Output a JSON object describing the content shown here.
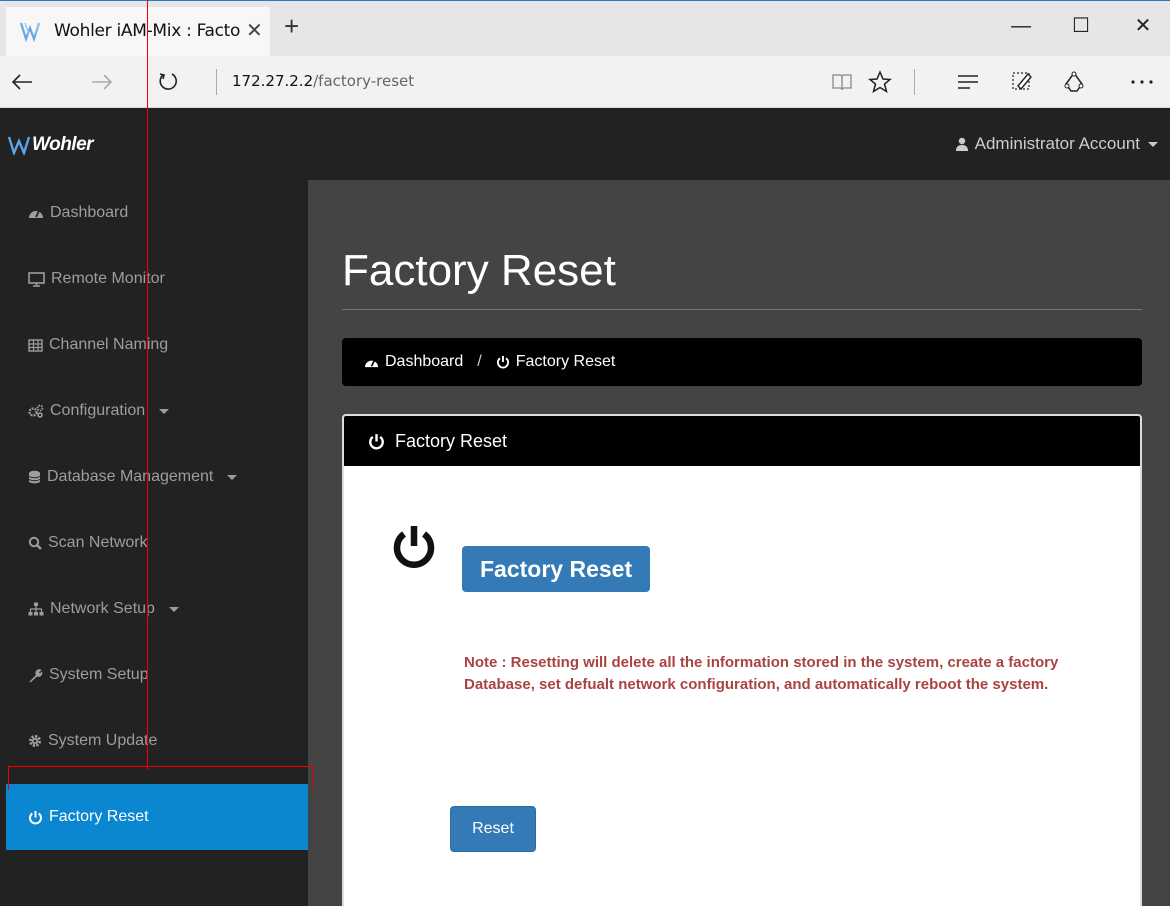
{
  "browser": {
    "tab_title": "Wohler iAM-Mix : Facto",
    "url_host": "172.27.2.2",
    "url_path": "/factory-reset"
  },
  "header": {
    "logo_text": "Wohler",
    "account_label": "Administrator Account"
  },
  "sidebar": {
    "items": [
      {
        "label": "Dashboard",
        "icon": "dashboard-icon"
      },
      {
        "label": "Remote Monitor",
        "icon": "monitor-icon"
      },
      {
        "label": "Channel Naming",
        "icon": "table-icon"
      },
      {
        "label": "Configuration",
        "icon": "gears-icon",
        "dropdown": true
      },
      {
        "label": "Database Management",
        "icon": "database-icon",
        "dropdown": true
      },
      {
        "label": "Scan Network",
        "icon": "search-icon"
      },
      {
        "label": "Network Setup",
        "icon": "sitemap-icon",
        "dropdown": true
      },
      {
        "label": "System Setup",
        "icon": "wrench-icon"
      },
      {
        "label": "System Update",
        "icon": "gear-icon"
      },
      {
        "label": "Factory Reset",
        "icon": "power-icon",
        "active": true
      }
    ]
  },
  "main": {
    "page_title": "Factory Reset",
    "breadcrumb": {
      "home": "Dashboard",
      "separator": "/",
      "current": "Factory Reset"
    },
    "panel": {
      "heading": "Factory Reset",
      "label_badge": "Factory Reset",
      "note": "Note : Resetting will delete all the information stored in the system, create a factory Database, set defualt network configuration, and automatically reboot the system.",
      "reset_button": "Reset"
    }
  },
  "colors": {
    "accent": "#0b86d0",
    "button": "#337ab7",
    "note_text": "#a94442",
    "sidebar_bg": "#222222",
    "main_bg": "#444444"
  }
}
